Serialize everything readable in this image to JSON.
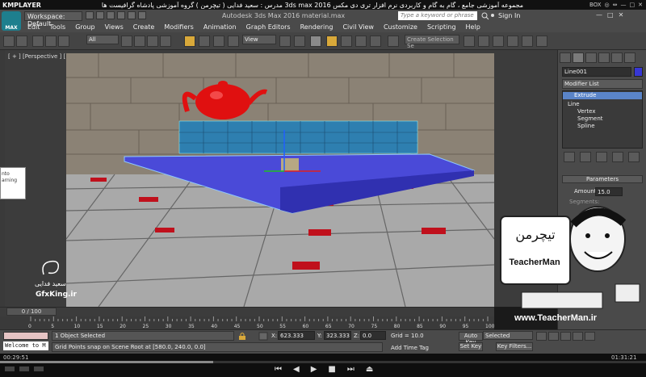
{
  "kmplayer": {
    "logo": "KMPLAYER",
    "title": "مجموعه آموزشی جامع ، گام به گام و کاربردی نرم افزار تری دی مکس 3ds max 2016 مدرس : سعید فدایی ( تیچرمن ) گروه آموزشی پادشاه گرافیست ها",
    "right_items": [
      "BOX",
      "◎",
      "⇔",
      "—",
      "□",
      "✕"
    ],
    "time_elapsed": "00:29:51",
    "time_total": "01:31:21",
    "progress": 0.33
  },
  "max": {
    "logo_label": "MAX",
    "workspace": "Workspace: Default",
    "app_title": "Autodesk 3ds Max 2016    material.max",
    "search_placeholder": "Type a keyword or phrase",
    "signin": "Sign In",
    "window_buttons": [
      "—",
      "□",
      "✕"
    ],
    "menus": [
      "Edit",
      "Tools",
      "Group",
      "Views",
      "Create",
      "Modifiers",
      "Animation",
      "Graph Editors",
      "Rendering",
      "Civil View",
      "Customize",
      "Scripting",
      "Help"
    ],
    "selection_filter": "All",
    "ref_coord": "View",
    "create_selection": "Create Selection Se"
  },
  "viewport": {
    "label": "[ + ] [Perspective ] [ Shaded ]"
  },
  "command_panel": {
    "object_name": "Line001",
    "object_color": "#3737d5",
    "modifier_list": "Modifier List",
    "stack": [
      "Extrude",
      "Line",
      "Vertex",
      "Segment",
      "Spline"
    ],
    "parameters_title": "Parameters",
    "amount_label": "Amount:",
    "amount_value": "15.0",
    "segments_label": "Segments:"
  },
  "overlay": {
    "teacher_url": "www.TeacherMan.ir",
    "teacher_brand": "TeacherMan",
    "teacher_brand_fa": "تیچرمن",
    "wm_name": "سعید فدایی",
    "wm_site": "GfxKing.ir",
    "float_a": "nto",
    "float_b": "arning"
  },
  "timeline": {
    "frame_counter": "0 / 100",
    "ticks": [
      "0",
      "5",
      "10",
      "15",
      "20",
      "25",
      "30",
      "35",
      "40",
      "45",
      "50",
      "55",
      "60",
      "65",
      "70",
      "75",
      "80",
      "85",
      "90",
      "95",
      "100"
    ]
  },
  "status": {
    "welcome": "Welcome to M",
    "line1": "1 Object Selected",
    "line2": "Grid Points snap on Scene Root at [580.0, 240.0, 0.0]",
    "x_label": "X:",
    "x_value": "623.333",
    "y_label": "Y:",
    "y_value": "323.333",
    "z_label": "Z:",
    "z_value": "0.0",
    "grid": "Grid = 10.0",
    "add_time_tag": "Add Time Tag",
    "auto_key": "Auto Key",
    "set_key": "Set Key",
    "selected": "Selected",
    "key_filters": "Key Filters..."
  }
}
